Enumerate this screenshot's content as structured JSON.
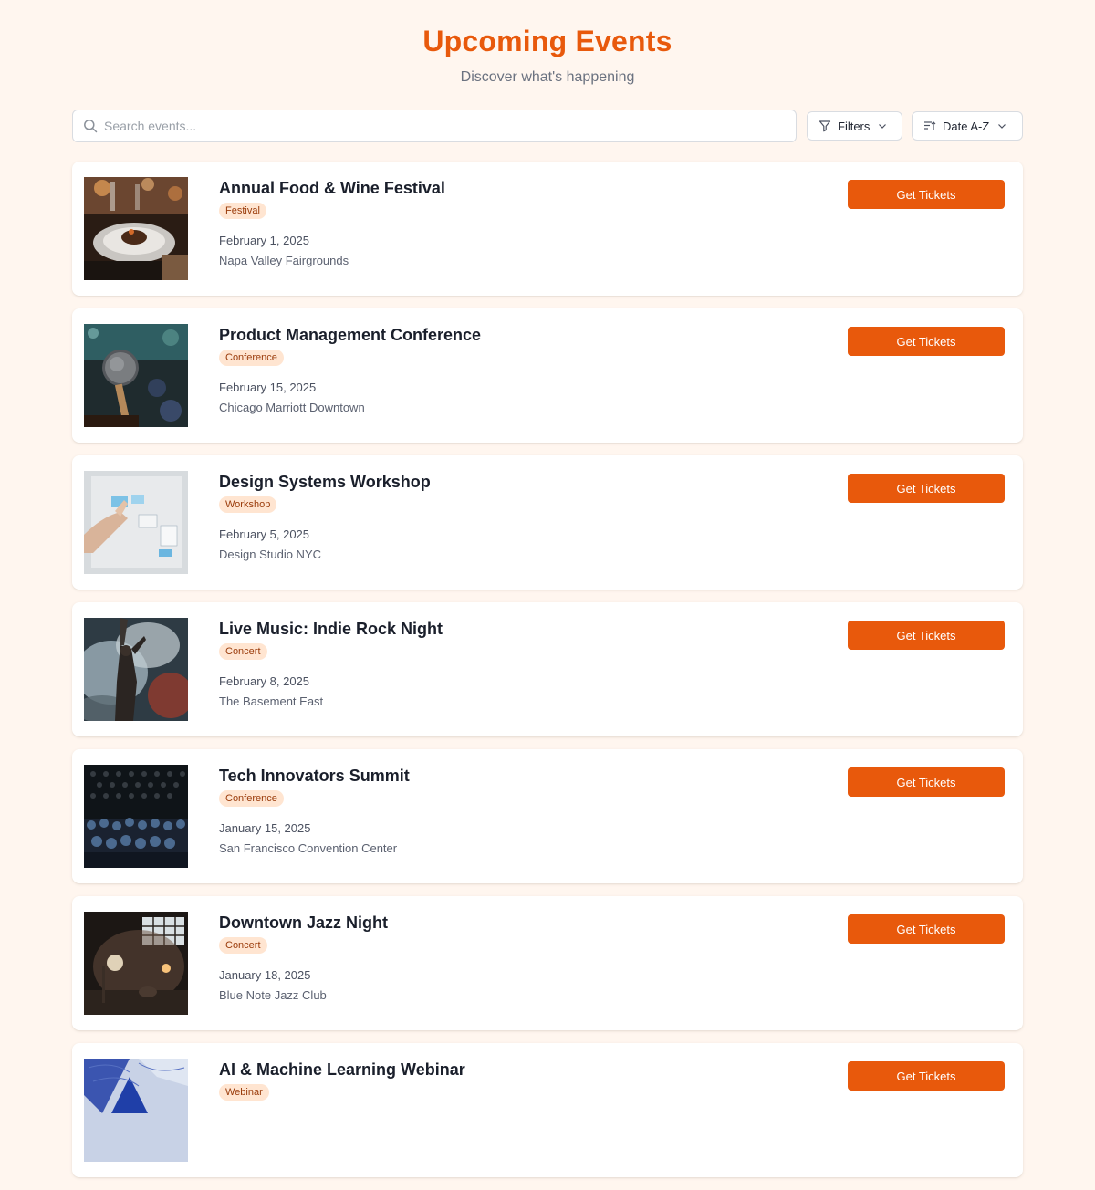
{
  "header": {
    "title": "Upcoming Events",
    "subtitle": "Discover what's happening"
  },
  "toolbar": {
    "search_placeholder": "Search events...",
    "filters_label": "Filters",
    "sort_label": "Date A-Z"
  },
  "theme": {
    "accent": "#e8590c",
    "badge_bg": "#ffe5d1",
    "page_bg": "#fff6ef"
  },
  "events": [
    {
      "title": "Annual Food & Wine Festival",
      "category": "Festival",
      "date": "February 1, 2025",
      "venue": "Napa Valley Fairgrounds",
      "button": "Get Tickets",
      "image": "dinner-plate-photo"
    },
    {
      "title": "Product Management Conference",
      "category": "Conference",
      "date": "February 15, 2025",
      "venue": "Chicago Marriott Downtown",
      "button": "Get Tickets",
      "image": "microphone-photo"
    },
    {
      "title": "Design Systems Workshop",
      "category": "Workshop",
      "date": "February 5, 2025",
      "venue": "Design Studio NYC",
      "button": "Get Tickets",
      "image": "whiteboard-notes-photo"
    },
    {
      "title": "Live Music: Indie Rock Night",
      "category": "Concert",
      "date": "February 8, 2025",
      "venue": "The Basement East",
      "button": "Get Tickets",
      "image": "concert-smoke-photo"
    },
    {
      "title": "Tech Innovators Summit",
      "category": "Conference",
      "date": "January 15, 2025",
      "venue": "San Francisco Convention Center",
      "button": "Get Tickets",
      "image": "auditorium-audience-photo"
    },
    {
      "title": "Downtown Jazz Night",
      "category": "Concert",
      "date": "January 18, 2025",
      "venue": "Blue Note Jazz Club",
      "button": "Get Tickets",
      "image": "jazz-stage-photo"
    },
    {
      "title": "AI & Machine Learning Webinar",
      "category": "Webinar",
      "date": "",
      "venue": "",
      "button": "Get Tickets",
      "image": "abstract-blue-photo"
    }
  ]
}
